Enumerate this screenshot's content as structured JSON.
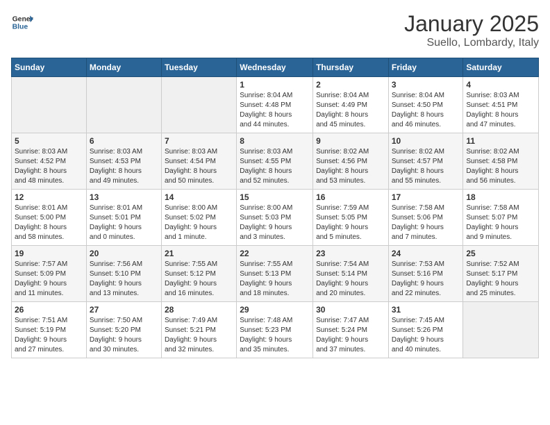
{
  "header": {
    "logo_general": "General",
    "logo_blue": "Blue",
    "title": "January 2025",
    "subtitle": "Suello, Lombardy, Italy"
  },
  "weekdays": [
    "Sunday",
    "Monday",
    "Tuesday",
    "Wednesday",
    "Thursday",
    "Friday",
    "Saturday"
  ],
  "weeks": [
    [
      {
        "day": "",
        "detail": ""
      },
      {
        "day": "",
        "detail": ""
      },
      {
        "day": "",
        "detail": ""
      },
      {
        "day": "1",
        "detail": "Sunrise: 8:04 AM\nSunset: 4:48 PM\nDaylight: 8 hours\nand 44 minutes."
      },
      {
        "day": "2",
        "detail": "Sunrise: 8:04 AM\nSunset: 4:49 PM\nDaylight: 8 hours\nand 45 minutes."
      },
      {
        "day": "3",
        "detail": "Sunrise: 8:04 AM\nSunset: 4:50 PM\nDaylight: 8 hours\nand 46 minutes."
      },
      {
        "day": "4",
        "detail": "Sunrise: 8:03 AM\nSunset: 4:51 PM\nDaylight: 8 hours\nand 47 minutes."
      }
    ],
    [
      {
        "day": "5",
        "detail": "Sunrise: 8:03 AM\nSunset: 4:52 PM\nDaylight: 8 hours\nand 48 minutes."
      },
      {
        "day": "6",
        "detail": "Sunrise: 8:03 AM\nSunset: 4:53 PM\nDaylight: 8 hours\nand 49 minutes."
      },
      {
        "day": "7",
        "detail": "Sunrise: 8:03 AM\nSunset: 4:54 PM\nDaylight: 8 hours\nand 50 minutes."
      },
      {
        "day": "8",
        "detail": "Sunrise: 8:03 AM\nSunset: 4:55 PM\nDaylight: 8 hours\nand 52 minutes."
      },
      {
        "day": "9",
        "detail": "Sunrise: 8:02 AM\nSunset: 4:56 PM\nDaylight: 8 hours\nand 53 minutes."
      },
      {
        "day": "10",
        "detail": "Sunrise: 8:02 AM\nSunset: 4:57 PM\nDaylight: 8 hours\nand 55 minutes."
      },
      {
        "day": "11",
        "detail": "Sunrise: 8:02 AM\nSunset: 4:58 PM\nDaylight: 8 hours\nand 56 minutes."
      }
    ],
    [
      {
        "day": "12",
        "detail": "Sunrise: 8:01 AM\nSunset: 5:00 PM\nDaylight: 8 hours\nand 58 minutes."
      },
      {
        "day": "13",
        "detail": "Sunrise: 8:01 AM\nSunset: 5:01 PM\nDaylight: 9 hours\nand 0 minutes."
      },
      {
        "day": "14",
        "detail": "Sunrise: 8:00 AM\nSunset: 5:02 PM\nDaylight: 9 hours\nand 1 minute."
      },
      {
        "day": "15",
        "detail": "Sunrise: 8:00 AM\nSunset: 5:03 PM\nDaylight: 9 hours\nand 3 minutes."
      },
      {
        "day": "16",
        "detail": "Sunrise: 7:59 AM\nSunset: 5:05 PM\nDaylight: 9 hours\nand 5 minutes."
      },
      {
        "day": "17",
        "detail": "Sunrise: 7:58 AM\nSunset: 5:06 PM\nDaylight: 9 hours\nand 7 minutes."
      },
      {
        "day": "18",
        "detail": "Sunrise: 7:58 AM\nSunset: 5:07 PM\nDaylight: 9 hours\nand 9 minutes."
      }
    ],
    [
      {
        "day": "19",
        "detail": "Sunrise: 7:57 AM\nSunset: 5:09 PM\nDaylight: 9 hours\nand 11 minutes."
      },
      {
        "day": "20",
        "detail": "Sunrise: 7:56 AM\nSunset: 5:10 PM\nDaylight: 9 hours\nand 13 minutes."
      },
      {
        "day": "21",
        "detail": "Sunrise: 7:55 AM\nSunset: 5:12 PM\nDaylight: 9 hours\nand 16 minutes."
      },
      {
        "day": "22",
        "detail": "Sunrise: 7:55 AM\nSunset: 5:13 PM\nDaylight: 9 hours\nand 18 minutes."
      },
      {
        "day": "23",
        "detail": "Sunrise: 7:54 AM\nSunset: 5:14 PM\nDaylight: 9 hours\nand 20 minutes."
      },
      {
        "day": "24",
        "detail": "Sunrise: 7:53 AM\nSunset: 5:16 PM\nDaylight: 9 hours\nand 22 minutes."
      },
      {
        "day": "25",
        "detail": "Sunrise: 7:52 AM\nSunset: 5:17 PM\nDaylight: 9 hours\nand 25 minutes."
      }
    ],
    [
      {
        "day": "26",
        "detail": "Sunrise: 7:51 AM\nSunset: 5:19 PM\nDaylight: 9 hours\nand 27 minutes."
      },
      {
        "day": "27",
        "detail": "Sunrise: 7:50 AM\nSunset: 5:20 PM\nDaylight: 9 hours\nand 30 minutes."
      },
      {
        "day": "28",
        "detail": "Sunrise: 7:49 AM\nSunset: 5:21 PM\nDaylight: 9 hours\nand 32 minutes."
      },
      {
        "day": "29",
        "detail": "Sunrise: 7:48 AM\nSunset: 5:23 PM\nDaylight: 9 hours\nand 35 minutes."
      },
      {
        "day": "30",
        "detail": "Sunrise: 7:47 AM\nSunset: 5:24 PM\nDaylight: 9 hours\nand 37 minutes."
      },
      {
        "day": "31",
        "detail": "Sunrise: 7:45 AM\nSunset: 5:26 PM\nDaylight: 9 hours\nand 40 minutes."
      },
      {
        "day": "",
        "detail": ""
      }
    ]
  ]
}
